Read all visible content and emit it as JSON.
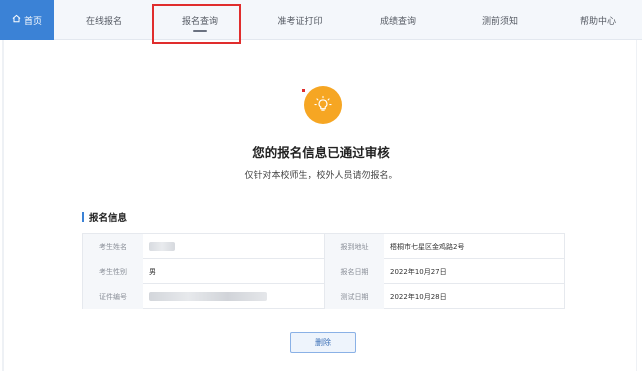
{
  "nav": {
    "home_label": "首页",
    "items": [
      {
        "label": "在线报名"
      },
      {
        "label": "报名查询"
      },
      {
        "label": "准考证打印"
      },
      {
        "label": "成绩查询"
      },
      {
        "label": "测前须知"
      },
      {
        "label": "帮助中心"
      }
    ],
    "active_index": 1,
    "colors": {
      "home_bg": "#3b82d6",
      "highlight": "#e02d2d"
    }
  },
  "hero": {
    "icon": "lightbulb-icon",
    "icon_color": "#f6a623",
    "title": "您的报名信息已通过审核",
    "subtitle": "仅针对本校师生，校外人员请勿报名。"
  },
  "section": {
    "title": "报名信息",
    "rows": [
      {
        "label_left": "考生姓名",
        "value_left": "",
        "label_right": "报到地址",
        "value_right": "梧桐市七星区金鸡路2号"
      },
      {
        "label_left": "考生性别",
        "value_left": "男",
        "label_right": "报名日期",
        "value_right": "2022年10月27日"
      },
      {
        "label_left": "证件编号",
        "value_left": "",
        "label_right": "测试日期",
        "value_right": "2022年10月28日"
      }
    ]
  },
  "actions": {
    "delete_label": "删除"
  }
}
